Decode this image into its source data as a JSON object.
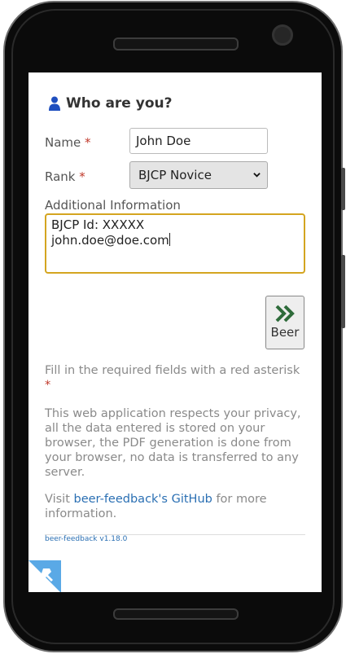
{
  "form": {
    "title": "Who are you?",
    "name_label": "Name",
    "name_value": "John Doe",
    "rank_label": "Rank",
    "rank_value": "BJCP Novice",
    "additional_label": "Additional Information",
    "additional_line1": "BJCP Id: XXXXX",
    "additional_line2": "john.doe@doe.com",
    "required_mark": "*"
  },
  "next_button": {
    "label": "Beer"
  },
  "info": {
    "required_note": "Fill in the required fields with a red asterisk",
    "privacy_note": "This web application respects your privacy, all the data entered is stored on your browser, the PDF generation is done from your browser, no data is transferred to any server.",
    "visit_prefix": "Visit ",
    "github_link": "beer-feedback's GitHub",
    "visit_suffix": " for more information."
  },
  "footer": {
    "version": "beer-feedback v1.18.0"
  },
  "icons": {
    "section": "person-icon",
    "next": "double-chevron-right-icon",
    "select": "chevron-down-icon",
    "corner": "pin-badge-icon"
  },
  "colors": {
    "link": "#2a6fb3",
    "required": "#c0392b",
    "focus_border": "#d4a520",
    "next_icon": "#2e6b3a",
    "corner_badge": "#5aa9e6"
  }
}
